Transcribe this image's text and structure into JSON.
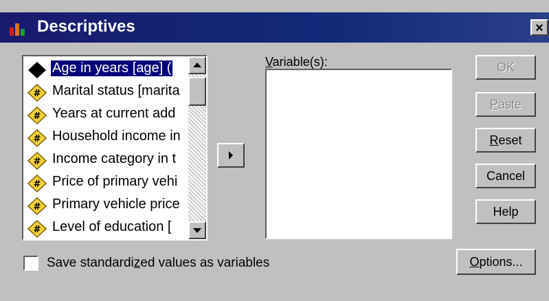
{
  "window": {
    "title": "Descriptives",
    "close_glyph": "×"
  },
  "source_list": {
    "items": [
      {
        "label": "Age in years [age] (",
        "icon": "scale-variable-icon",
        "selected": true
      },
      {
        "label": "Marital status [marita",
        "icon": "nominal-variable-icon",
        "selected": false
      },
      {
        "label": "Years at current add",
        "icon": "nominal-variable-icon",
        "selected": false
      },
      {
        "label": "Household income in",
        "icon": "nominal-variable-icon",
        "selected": false
      },
      {
        "label": "Income category in t",
        "icon": "nominal-variable-icon",
        "selected": false
      },
      {
        "label": "Price of primary vehi",
        "icon": "nominal-variable-icon",
        "selected": false
      },
      {
        "label": "Primary vehicle price",
        "icon": "nominal-variable-icon",
        "selected": false
      },
      {
        "label": "Level of education [",
        "icon": "nominal-variable-icon",
        "selected": false
      }
    ]
  },
  "target": {
    "label_prefix": "",
    "label_underline": "V",
    "label_rest": "ariable(s):",
    "items": []
  },
  "buttons": {
    "ok": {
      "label": "OK",
      "enabled": false
    },
    "paste": {
      "pre": "",
      "u": "P",
      "post": "aste",
      "enabled": false
    },
    "reset": {
      "pre": "",
      "u": "R",
      "post": "eset",
      "enabled": true
    },
    "cancel": {
      "label": "Cancel",
      "enabled": true
    },
    "help": {
      "label": "Help",
      "enabled": true
    },
    "options": {
      "pre": "",
      "u": "O",
      "post": "ptions...",
      "enabled": true
    }
  },
  "checkbox": {
    "pre": "Save standardi",
    "u": "z",
    "post": "ed values as variables",
    "checked": false
  },
  "colors": {
    "title_bar": "#1a1a6e",
    "selection": "#00007a",
    "dialog_bg": "#c0c0c0"
  }
}
